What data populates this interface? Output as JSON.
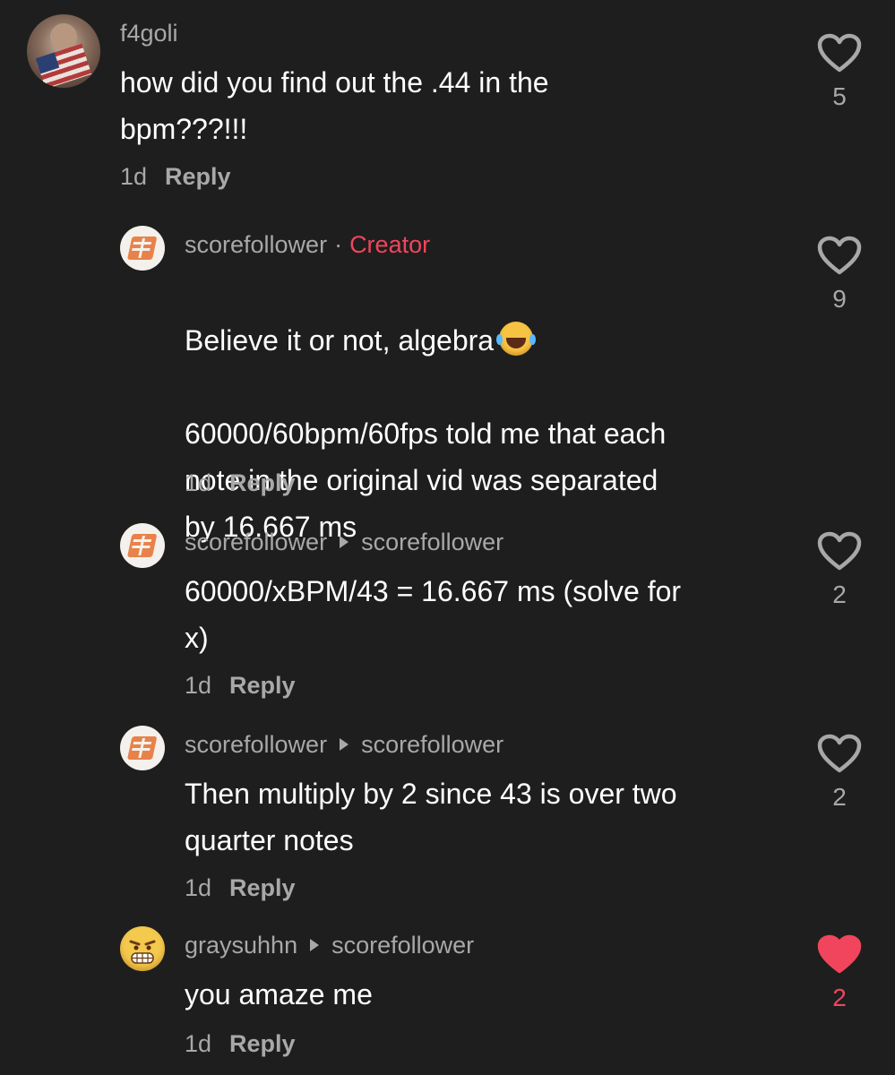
{
  "comments": [
    {
      "username": "f4goli",
      "text": "how did you find out the .44 in the\nbpm???!!!",
      "time": "1d",
      "reply_label": "Reply",
      "likes": "5",
      "liked": false
    },
    {
      "username": "scorefollower",
      "separator": "·",
      "badge": "Creator",
      "text_line1": "Believe it or not, algebra",
      "text_rest": "60000/60bpm/60fps told me that each\nnote in the original vid was separated\nby 16.667 ms",
      "emoji": "face-with-tears-of-joy",
      "time": "1d",
      "reply_label": "Reply",
      "likes": "9",
      "liked": false
    },
    {
      "username": "scorefollower",
      "reply_to": "scorefollower",
      "text": "60000/xBPM/43 = 16.667 ms (solve for\nx)",
      "time": "1d",
      "reply_label": "Reply",
      "likes": "2",
      "liked": false
    },
    {
      "username": "scorefollower",
      "reply_to": "scorefollower",
      "text": "Then multiply by 2 since 43 is over two\nquarter notes",
      "time": "1d",
      "reply_label": "Reply",
      "likes": "2",
      "liked": false
    },
    {
      "username": "graysuhhn",
      "reply_to": "scorefollower",
      "text": "you amaze me",
      "time": "1d",
      "reply_label": "Reply",
      "likes": "2",
      "liked": true
    }
  ],
  "colors": {
    "background": "#1e1e1e",
    "text": "#ffffff",
    "muted": "#a8a8a8",
    "accent": "#f0455c"
  },
  "icons": {
    "like": "heart-outline-icon",
    "liked": "heart-filled-icon",
    "reply_arrow": "caret-right-icon"
  }
}
